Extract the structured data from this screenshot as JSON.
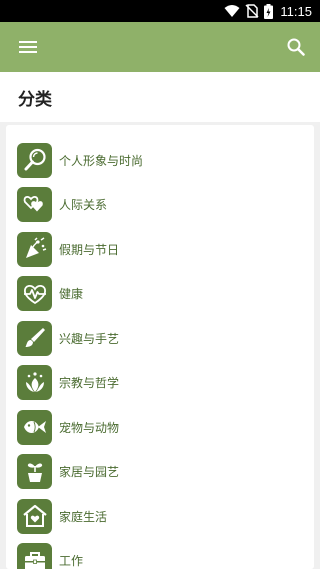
{
  "status_bar": {
    "time": "11:15"
  },
  "app_bar": {
    "menu_icon": "menu-icon",
    "search_icon": "search-icon",
    "color": "#8fb169"
  },
  "header": {
    "title": "分类"
  },
  "categories": [
    {
      "label": "个人形象与时尚",
      "icon": "mirror-icon"
    },
    {
      "label": "人际关系",
      "icon": "hearts-icon"
    },
    {
      "label": "假期与节日",
      "icon": "party-icon"
    },
    {
      "label": "健康",
      "icon": "heartbeat-icon"
    },
    {
      "label": "兴趣与手艺",
      "icon": "brush-icon"
    },
    {
      "label": "宗教与哲学",
      "icon": "lotus-icon"
    },
    {
      "label": "宠物与动物",
      "icon": "fish-icon"
    },
    {
      "label": "家居与园艺",
      "icon": "plant-pot-icon"
    },
    {
      "label": "家庭生活",
      "icon": "home-heart-icon"
    },
    {
      "label": "工作",
      "icon": "briefcase-icon"
    }
  ],
  "accent": "#5b7d3b"
}
